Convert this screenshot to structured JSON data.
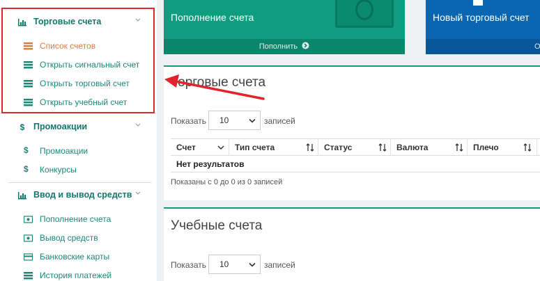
{
  "sidebar": {
    "groups": [
      {
        "title": "Торговые счета",
        "items": [
          "Список счетов",
          "Открыть сигнальный счет",
          "Открыть торговый счет",
          "Открыть учебный счет"
        ]
      },
      {
        "title": "Промоакции",
        "items": [
          "Промоакции",
          "Конкурсы"
        ]
      },
      {
        "title": "Ввод и вывод средств",
        "items": [
          "Пополнение счета",
          "Вывод средств",
          "Банковские карты",
          "История платежей"
        ]
      }
    ],
    "promo_icon_glyph": "$"
  },
  "cards": {
    "deposit_title": "Пополнение счета",
    "deposit_action": "Пополнить",
    "new_account_title": "Новый торговый счет",
    "new_account_action": "Откр"
  },
  "trading_panel": {
    "title": "Торговые счета",
    "show_label": "Показать",
    "page_size": "10",
    "records_label": "записей",
    "columns": [
      "Счет",
      "Тип счета",
      "Статус",
      "Валюта",
      "Плечо"
    ],
    "no_results": "Нет результатов",
    "info": "Показаны с 0 до 0 из 0 записей"
  },
  "training_panel": {
    "title": "Учебные счета",
    "show_label": "Показать",
    "page_size": "10",
    "records_label": "записей"
  },
  "colors": {
    "accent_green": "#0e9e7f",
    "accent_blue": "#0a66b1",
    "active_orange": "#e07b3c",
    "highlight_red": "#e0242a"
  }
}
